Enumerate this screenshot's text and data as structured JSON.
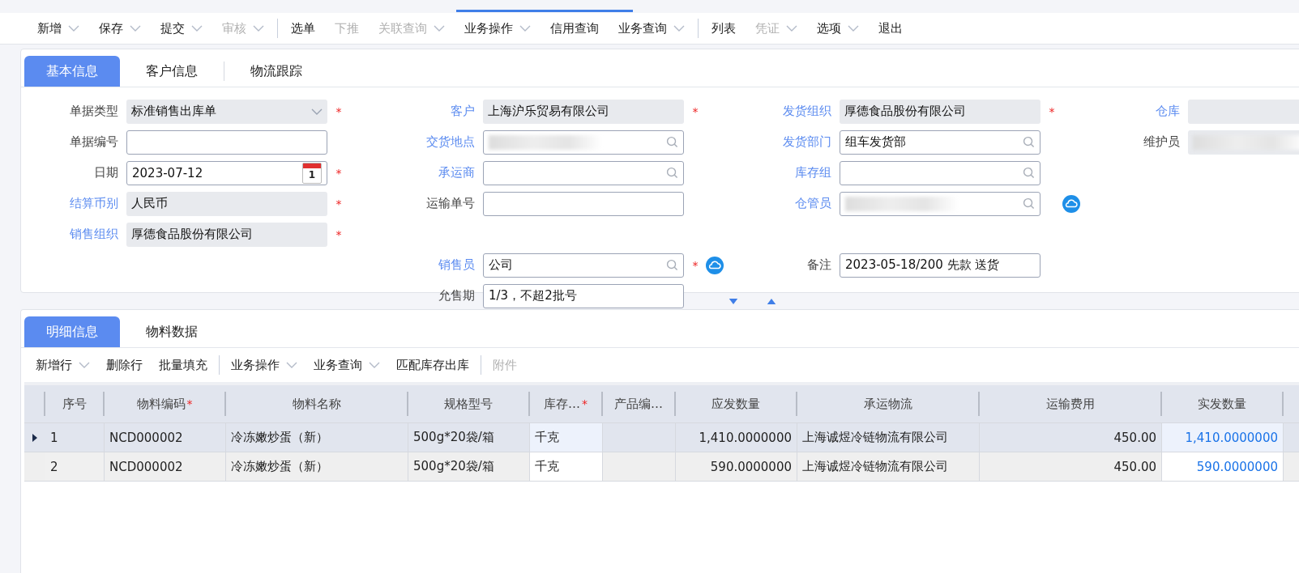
{
  "toolbar": {
    "groups": [
      [
        {
          "label": "新增",
          "dropdown": true,
          "disabled": false
        },
        {
          "label": "保存",
          "dropdown": true,
          "disabled": false
        },
        {
          "label": "提交",
          "dropdown": true,
          "disabled": false
        },
        {
          "label": "审核",
          "dropdown": true,
          "disabled": true
        }
      ],
      [
        {
          "label": "选单",
          "dropdown": false,
          "disabled": false
        },
        {
          "label": "下推",
          "dropdown": false,
          "disabled": true
        },
        {
          "label": "关联查询",
          "dropdown": true,
          "disabled": true
        },
        {
          "label": "业务操作",
          "dropdown": true,
          "disabled": false
        },
        {
          "label": "信用查询",
          "dropdown": false,
          "disabled": false
        },
        {
          "label": "业务查询",
          "dropdown": true,
          "disabled": false
        }
      ],
      [
        {
          "label": "列表",
          "dropdown": false,
          "disabled": false
        },
        {
          "label": "凭证",
          "dropdown": true,
          "disabled": true
        },
        {
          "label": "选项",
          "dropdown": true,
          "disabled": false
        },
        {
          "label": "退出",
          "dropdown": false,
          "disabled": false
        }
      ]
    ]
  },
  "header_tabs": [
    {
      "label": "基本信息",
      "selected": true
    },
    {
      "label": "客户信息",
      "selected": false
    },
    {
      "label": "物流跟踪",
      "selected": false
    }
  ],
  "form_columns": [
    [
      {
        "label": "单据类型",
        "link": false,
        "kind": "select",
        "value": "标准销售出库单",
        "mark": "*"
      },
      {
        "label": "单据编号",
        "link": false,
        "kind": "text"
      },
      {
        "label": "日期",
        "link": false,
        "kind": "date",
        "value": "2023-07-12",
        "mark": "*",
        "calendar_day": "1"
      },
      {
        "label": "结算币别",
        "link": true,
        "kind": "readonly",
        "value": "人民币",
        "mark": "*"
      },
      {
        "label": "销售组织",
        "link": true,
        "kind": "readonly",
        "value": "厚德食品股份有限公司",
        "mark": "*"
      }
    ],
    [
      {
        "label": "客户",
        "link": true,
        "kind": "readonly",
        "value": "上海沪乐贸易有限公司",
        "mark": "*"
      },
      {
        "label": "交货地点",
        "link": true,
        "kind": "lookup",
        "blurred": true
      },
      {
        "label": "承运商",
        "link": true,
        "kind": "lookup"
      },
      {
        "label": "运输单号",
        "link": false,
        "kind": "text"
      },
      {
        "label": "销售员",
        "link": true,
        "kind": "lookup",
        "value": "公司",
        "mark": "*",
        "cloud_button": true
      },
      {
        "label": "允售期",
        "link": false,
        "kind": "text",
        "value": "1/3，不超2批号"
      }
    ],
    [
      {
        "label": "发货组织",
        "link": true,
        "kind": "readonly",
        "value": "厚德食品股份有限公司",
        "mark": "*"
      },
      {
        "label": "发货部门",
        "link": true,
        "kind": "lookup",
        "value": "组车发货部"
      },
      {
        "label": "库存组",
        "link": true,
        "kind": "lookup"
      },
      {
        "label": "仓管员",
        "link": true,
        "kind": "lookup",
        "blurred": true,
        "cloud_button": true
      },
      {
        "label": "备注",
        "link": false,
        "kind": "text",
        "value": "2023-05-18/200 先款 送货"
      }
    ],
    [
      {
        "label": "仓库",
        "link": true,
        "kind": "readonly"
      },
      {
        "label": "维护员",
        "link": false,
        "kind": "readonly",
        "blurred": true
      }
    ]
  ],
  "detail_tabs": [
    {
      "label": "明细信息",
      "selected": true
    },
    {
      "label": "物料数据",
      "selected": false
    }
  ],
  "detail_toolbar": {
    "groups": [
      [
        {
          "label": "新增行",
          "dropdown": true,
          "disabled": false
        },
        {
          "label": "删除行",
          "dropdown": false,
          "disabled": false
        },
        {
          "label": "批量填充",
          "dropdown": false,
          "disabled": false
        }
      ],
      [
        {
          "label": "业务操作",
          "dropdown": true,
          "disabled": false
        },
        {
          "label": "业务查询",
          "dropdown": true,
          "disabled": false
        },
        {
          "label": "匹配库存出库",
          "dropdown": false,
          "disabled": false
        }
      ],
      [
        {
          "label": "附件",
          "dropdown": false,
          "disabled": true
        }
      ]
    ]
  },
  "table": {
    "columns": [
      {
        "label": "序号",
        "kind": "index"
      },
      {
        "label": "物料编码",
        "kind": "text",
        "mark": "*"
      },
      {
        "label": "物料名称",
        "kind": "text"
      },
      {
        "label": "规格型号",
        "kind": "text"
      },
      {
        "label": "库存…",
        "kind": "input-text",
        "mark": "*"
      },
      {
        "label": "产品编…",
        "kind": "text"
      },
      {
        "label": "应发数量",
        "kind": "number"
      },
      {
        "label": "承运物流",
        "kind": "text"
      },
      {
        "label": "运输费用",
        "kind": "number"
      },
      {
        "label": "实发数量",
        "kind": "input-number"
      }
    ],
    "rows": [
      {
        "selected": true,
        "cells": [
          "1",
          "NCD000002",
          "冷冻嫩炒蛋（新）",
          "500g*20袋/箱",
          "千克",
          "",
          "1,410.0000000",
          "上海诚煜冷链物流有限公司",
          "450.00",
          "1,410.0000000"
        ]
      },
      {
        "selected": false,
        "cells": [
          "2",
          "NCD000002",
          "冷冻嫩炒蛋（新）",
          "500g*20袋/箱",
          "千克",
          "",
          "590.0000000",
          "上海诚煜冷链物流有限公司",
          "450.00",
          "590.0000000"
        ]
      }
    ]
  }
}
